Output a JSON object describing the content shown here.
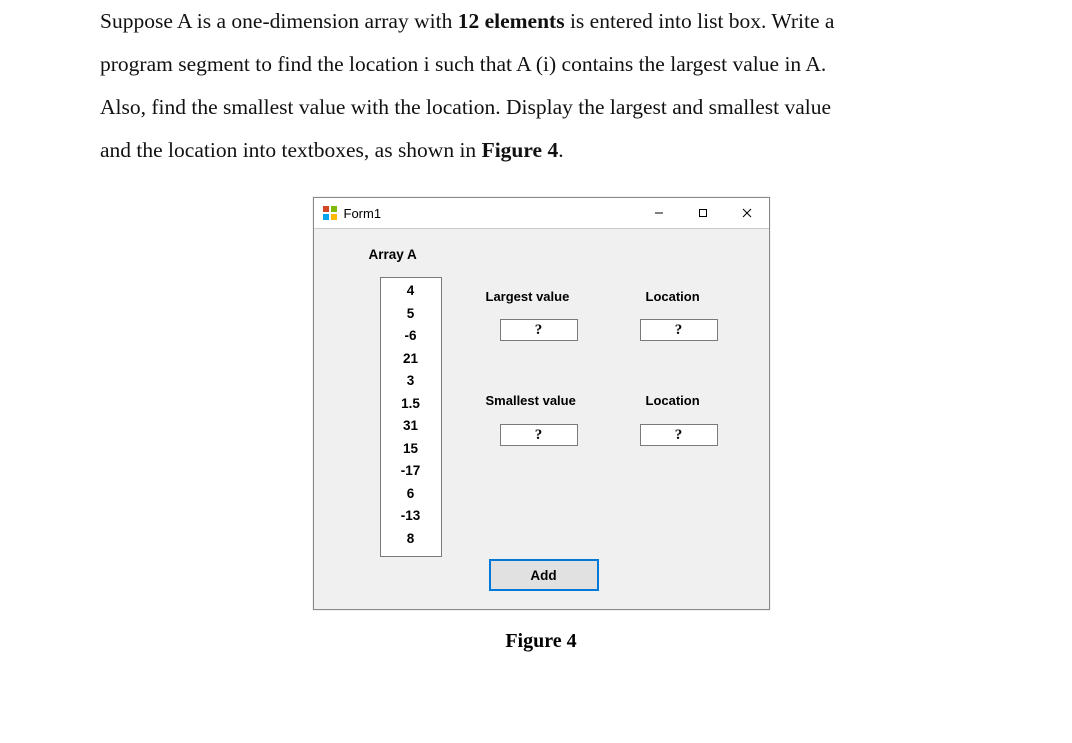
{
  "prompt": {
    "l1a": "Suppose A is a one-dimension array with ",
    "l1b": "12 elements",
    "l1c": " is entered into list box. Write a",
    "l2": "program segment to find the location i such that A (i) contains the largest value in A.",
    "l3": "Also, find the smallest value with the location. Display the largest and smallest value",
    "l4a": "and the location into textboxes, as shown in ",
    "l4b": "Figure 4",
    "l4c": "."
  },
  "window": {
    "title": "Form1",
    "minimize": "–",
    "maximize": "▢",
    "close": "✕"
  },
  "form": {
    "array_label": "Array A",
    "listbox_items": [
      "4",
      "5",
      "-6",
      "21",
      "3",
      "1.5",
      "31",
      "15",
      "-17",
      "6",
      "-13",
      "8"
    ],
    "largest_value_label": "Largest value",
    "largest_location_label": "Location",
    "smallest_value_label": "Smallest value",
    "smallest_location_label": "Location",
    "tb_largest_value": "?",
    "tb_largest_location": "?",
    "tb_smallest_value": "?",
    "tb_smallest_location": "?",
    "add_button": "Add"
  },
  "caption": "Figure 4"
}
